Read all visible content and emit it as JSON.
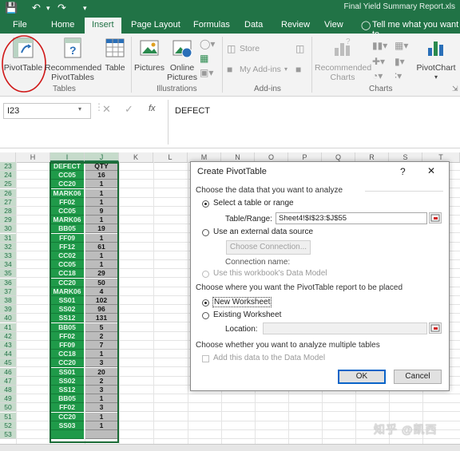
{
  "window": {
    "title": "Final Yield Summary Report.xls"
  },
  "ribbon_tabs": [
    "File",
    "Home",
    "Insert",
    "Page Layout",
    "Formulas",
    "Data",
    "Review",
    "View"
  ],
  "tell_me": "Tell me what you want to",
  "ribbon": {
    "pivottable": "PivotTable",
    "recommended_pivottables": [
      "Recommended",
      "PivotTables"
    ],
    "table": "Table",
    "pictures": "Pictures",
    "online_pictures": [
      "Online",
      "Pictures"
    ],
    "store": "Store",
    "my_addins": "My Add-ins",
    "recommended_charts": [
      "Recommended",
      "Charts"
    ],
    "pivotchart": "PivotChart",
    "groups": {
      "tables": "Tables",
      "illustrations": "Illustrations",
      "addins": "Add-ins",
      "charts": "Charts"
    },
    "accent_color": "#217346"
  },
  "formula_bar": {
    "name_box": "I23",
    "fx": "fx",
    "content": "DEFECT"
  },
  "columns": [
    "H",
    "I",
    "J",
    "K",
    "L",
    "M",
    "N",
    "O",
    "P",
    "Q",
    "R",
    "S",
    "T"
  ],
  "rows": [
    {
      "n": "23",
      "defect": "DEFECT",
      "qty": "QTY"
    },
    {
      "n": "24",
      "defect": "CC05",
      "qty": "16"
    },
    {
      "n": "25",
      "defect": "CC20",
      "qty": "1"
    },
    {
      "n": "26",
      "defect": "MARK06",
      "qty": "1"
    },
    {
      "n": "27",
      "defect": "FF02",
      "qty": "1"
    },
    {
      "n": "28",
      "defect": "CC05",
      "qty": "9"
    },
    {
      "n": "29",
      "defect": "MARK06",
      "qty": "1"
    },
    {
      "n": "30",
      "defect": "BB05",
      "qty": "19"
    },
    {
      "n": "31",
      "defect": "FF09",
      "qty": "1"
    },
    {
      "n": "32",
      "defect": "FF12",
      "qty": "61"
    },
    {
      "n": "33",
      "defect": "CC02",
      "qty": "1"
    },
    {
      "n": "34",
      "defect": "CC05",
      "qty": "1"
    },
    {
      "n": "35",
      "defect": "CC18",
      "qty": "29"
    },
    {
      "n": "36",
      "defect": "CC20",
      "qty": "50"
    },
    {
      "n": "37",
      "defect": "MARK06",
      "qty": "4"
    },
    {
      "n": "38",
      "defect": "SS01",
      "qty": "102"
    },
    {
      "n": "39",
      "defect": "SS02",
      "qty": "96"
    },
    {
      "n": "40",
      "defect": "SS12",
      "qty": "131"
    },
    {
      "n": "41",
      "defect": "BB05",
      "qty": "5"
    },
    {
      "n": "42",
      "defect": "FF02",
      "qty": "2"
    },
    {
      "n": "43",
      "defect": "FF09",
      "qty": "7"
    },
    {
      "n": "44",
      "defect": "CC18",
      "qty": "1"
    },
    {
      "n": "45",
      "defect": "CC20",
      "qty": "3"
    },
    {
      "n": "46",
      "defect": "SS01",
      "qty": "20"
    },
    {
      "n": "47",
      "defect": "SS02",
      "qty": "2"
    },
    {
      "n": "48",
      "defect": "SS12",
      "qty": "3"
    },
    {
      "n": "49",
      "defect": "BB05",
      "qty": "1"
    },
    {
      "n": "50",
      "defect": "FF02",
      "qty": "3"
    },
    {
      "n": "51",
      "defect": "CC20",
      "qty": "1"
    },
    {
      "n": "52",
      "defect": "SS03",
      "qty": "1"
    },
    {
      "n": "53",
      "defect": "",
      "qty": ""
    }
  ],
  "dialog": {
    "title": "Create PivotTable",
    "help": "?",
    "close": "✕",
    "section1": "Choose the data that you want to analyze",
    "opt_range": "Select a table or range",
    "table_range_label": "Table/Range:",
    "table_range_value": "Sheet4!$I$23:$J$55",
    "opt_external": "Use an external data source",
    "choose_connection": "Choose Connection...",
    "connection_name": "Connection name:",
    "opt_datamodel": "Use this workbook's Data Model",
    "section2": "Choose where you want the PivotTable report to be placed",
    "opt_new_ws": "New Worksheet",
    "opt_existing_ws": "Existing Worksheet",
    "location_label": "Location:",
    "location_value": "",
    "section3": "Choose whether you want to analyze multiple tables",
    "add_data_model": "Add this data to the Data Model",
    "ok": "OK",
    "cancel": "Cancel"
  },
  "watermark": "知乎 @凯西"
}
